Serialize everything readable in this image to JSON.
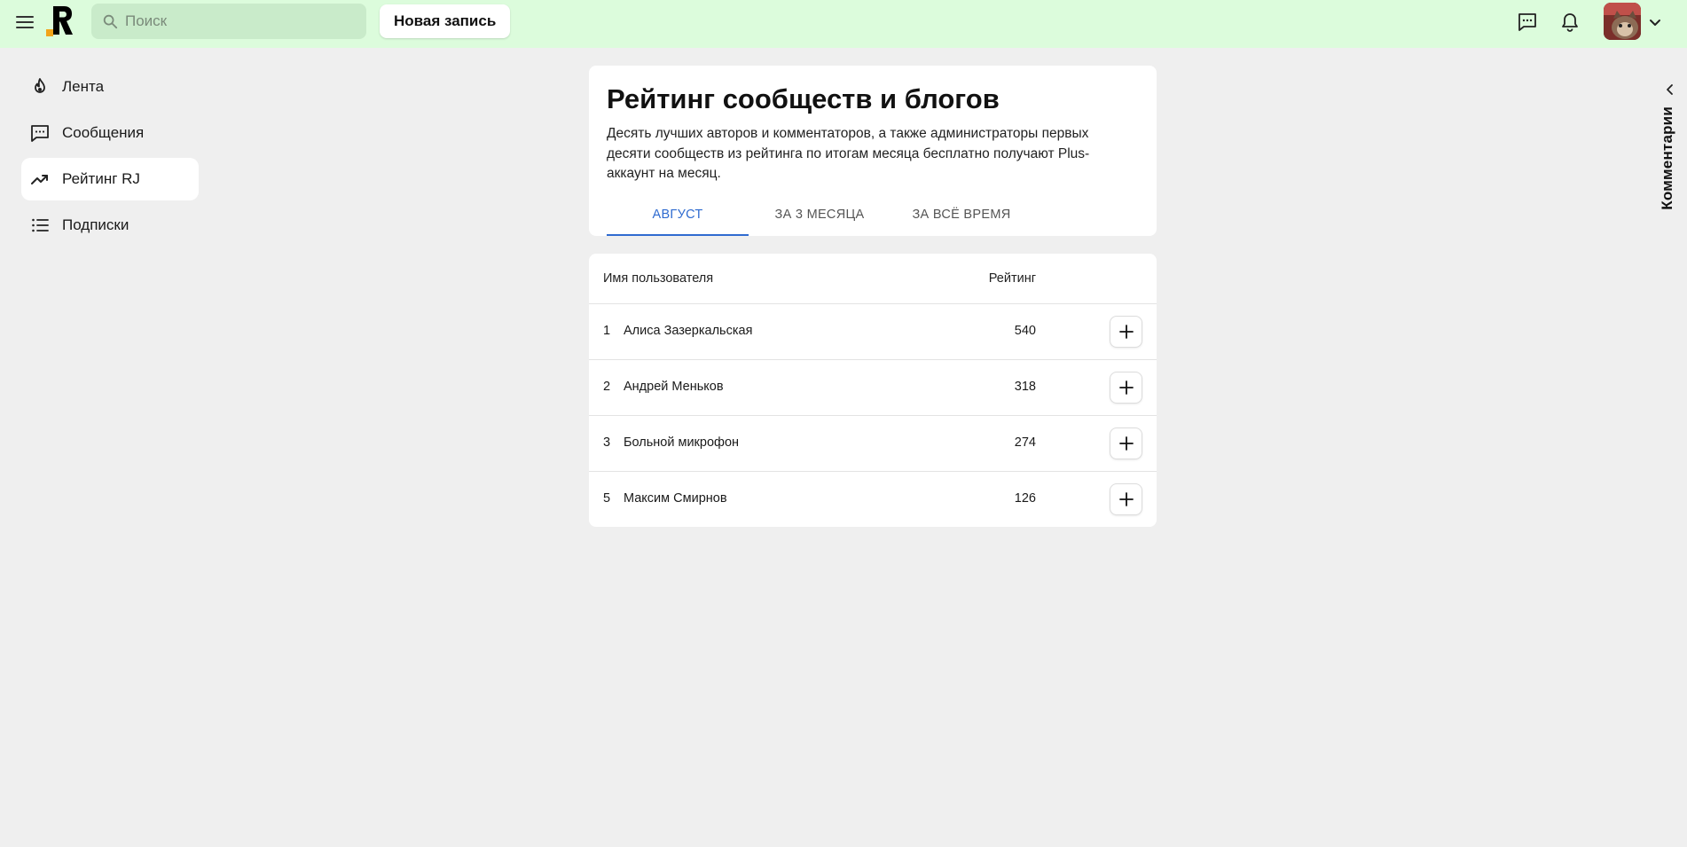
{
  "header": {
    "search_placeholder": "Поиск",
    "new_post_label": "Новая запись",
    "icons": [
      "menu-icon",
      "logo",
      "search-icon",
      "chat-icon",
      "bell-icon",
      "avatar",
      "chevron-down-icon"
    ]
  },
  "sidebar": {
    "items": [
      {
        "label": "Лента",
        "icon": "flame-icon",
        "active": false
      },
      {
        "label": "Сообщения",
        "icon": "message-icon",
        "active": false
      },
      {
        "label": "Рейтинг RJ",
        "icon": "trending-icon",
        "active": true
      },
      {
        "label": "Подписки",
        "icon": "list-icon",
        "active": false
      }
    ]
  },
  "main": {
    "title": "Рейтинг сообществ и блогов",
    "description": "Десять лучших авторов и комментаторов, а также администраторы первых десяти сообществ из рейтинга по итогам месяца бесплатно получают Plus-аккаунт на месяц.",
    "tabs": [
      {
        "label": "АВГУСТ",
        "active": true
      },
      {
        "label": "ЗА 3 МЕСЯЦА",
        "active": false
      },
      {
        "label": "ЗА ВСЁ ВРЕМЯ",
        "active": false
      }
    ],
    "table": {
      "headers": {
        "name": "Имя пользователя",
        "rating": "Рейтинг"
      },
      "rows": [
        {
          "rank": "1",
          "name": "Алиса Зазеркальская",
          "rating": "540"
        },
        {
          "rank": "2",
          "name": "Андрей Меньков",
          "rating": "318"
        },
        {
          "rank": "3",
          "name": "Больной микрофон",
          "rating": "274"
        },
        {
          "rank": "5",
          "name": "Максим Смирнов",
          "rating": "126"
        }
      ]
    }
  },
  "right_panel": {
    "label": "Комментарии"
  },
  "colors": {
    "header_bg": "#dcfcdc",
    "search_bg": "#c9ebca",
    "page_bg": "#efefef",
    "accent": "#2f6bd0"
  }
}
